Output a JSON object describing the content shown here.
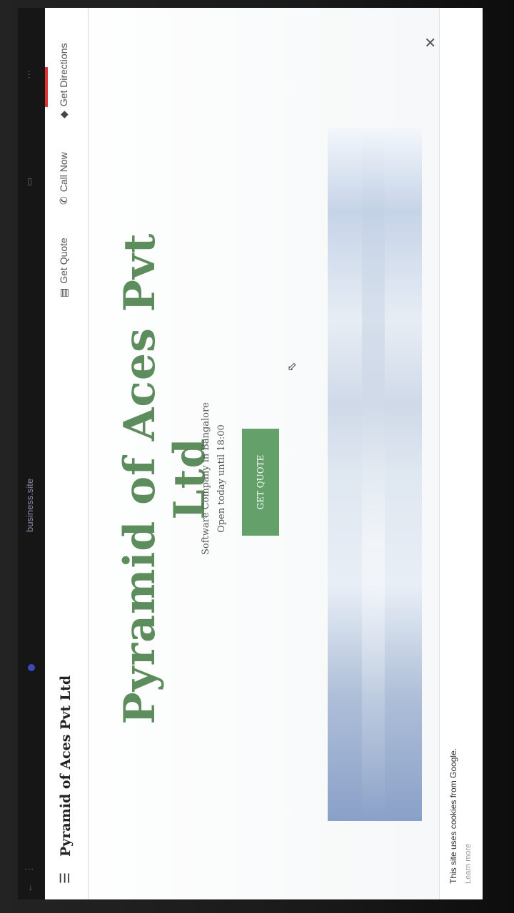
{
  "browser": {
    "url_text": "business.site"
  },
  "header": {
    "brand": "Pyramid of Aces Pvt Ltd",
    "nav": [
      {
        "icon": "quote-icon",
        "label": "Get Quote"
      },
      {
        "icon": "phone-icon",
        "label": "Call Now"
      },
      {
        "icon": "directions-icon",
        "label": "Get Directions"
      }
    ]
  },
  "hero": {
    "title": "Pyramid of Aces Pvt Ltd",
    "subtitle": "Software Company in Bangalore",
    "hours": "Open today until 18:00",
    "cta_label": "GET QUOTE"
  },
  "cookie_banner": {
    "text": "This site uses cookies from Google.",
    "learn_more": "Learn more"
  },
  "colors": {
    "brand_green": "#64a06a",
    "title_green": "#5d8c5d"
  }
}
